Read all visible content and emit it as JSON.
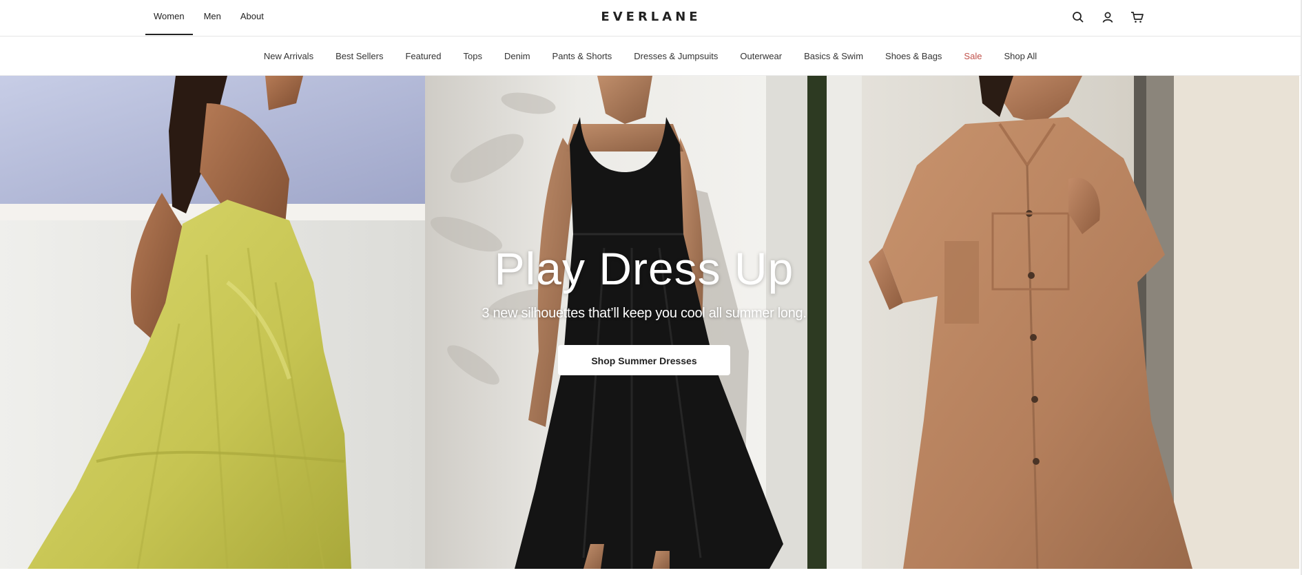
{
  "header": {
    "gender_tabs": [
      {
        "label": "Women",
        "active": true
      },
      {
        "label": "Men",
        "active": false
      },
      {
        "label": "About",
        "active": false
      }
    ],
    "logo": "EVERLANE",
    "icons": [
      "search-icon",
      "account-icon",
      "cart-icon"
    ]
  },
  "categories": [
    {
      "label": "New Arrivals"
    },
    {
      "label": "Best Sellers"
    },
    {
      "label": "Featured"
    },
    {
      "label": "Tops"
    },
    {
      "label": "Denim"
    },
    {
      "label": "Pants & Shorts"
    },
    {
      "label": "Dresses & Jumpsuits"
    },
    {
      "label": "Outerwear"
    },
    {
      "label": "Basics & Swim"
    },
    {
      "label": "Shoes & Bags"
    },
    {
      "label": "Sale",
      "highlight": "#c0504a"
    },
    {
      "label": "Shop All"
    }
  ],
  "hero": {
    "title": "Play Dress Up",
    "subtitle": "3 new silhouettes that’ll keep you cool all summer long.",
    "cta_label": "Shop Summer Dresses",
    "panels": [
      "yellow tiered dress",
      "black tank midi dress",
      "tan shirt dress"
    ]
  },
  "colors": {
    "sale": "#c0504a",
    "text": "#222222",
    "yellow_dress": "#c9c85a",
    "black_dress": "#141414",
    "tan_dress": "#b98360"
  }
}
